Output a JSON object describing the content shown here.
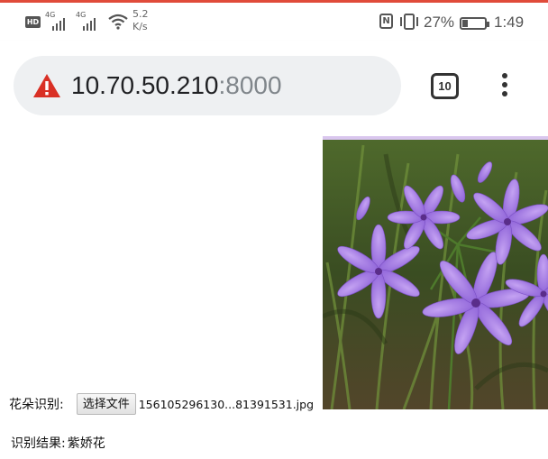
{
  "status_bar": {
    "hd_badge": "HD",
    "signal_1_tag": "4G",
    "signal_2_tag": "4G",
    "net_speed_value": "5.2",
    "net_speed_unit": "K/s",
    "nfc_letter": "N",
    "battery_text": "27%",
    "battery_level": 0.27,
    "time": "1:49"
  },
  "browser": {
    "url_host": "10.70.50.210",
    "url_port": ":8000",
    "tab_count": "10",
    "warning_color": "#d93025"
  },
  "page": {
    "upload_label": "花朵识别:",
    "file_button_label": "选择文件",
    "file_name": "156105296130...81391531.jpg",
    "result_label": "识别结果:",
    "result_value": "紫娇花"
  }
}
